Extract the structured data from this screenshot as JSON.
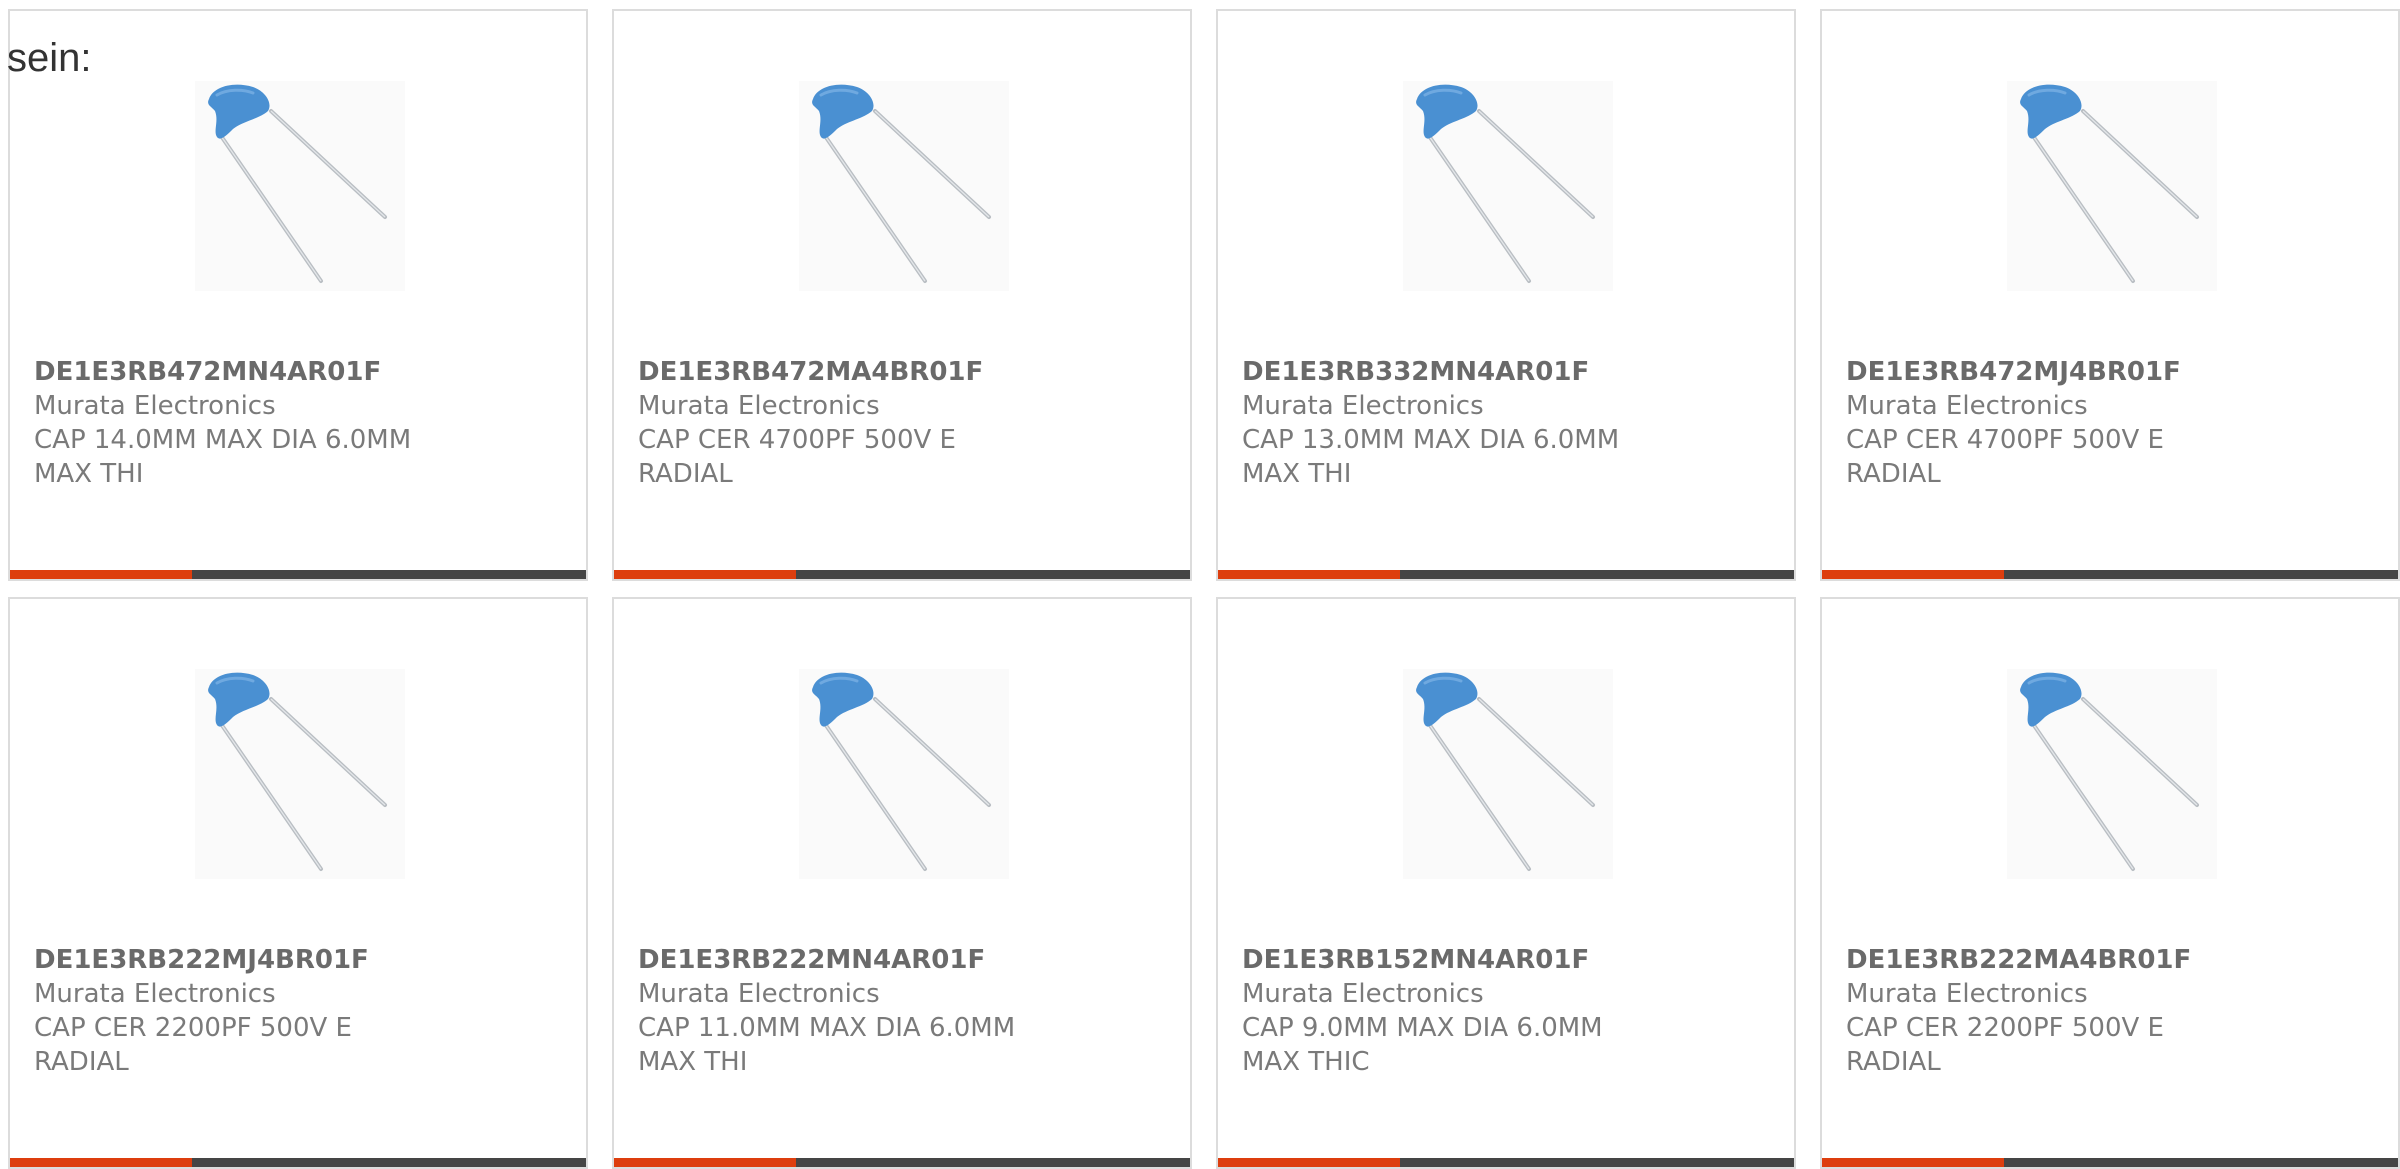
{
  "intro_text": "sein:",
  "colors": {
    "accent": "#dd3e0e",
    "bar": "#454545",
    "capacitor_body": "#4a90d2",
    "border": "#dcdcdc"
  },
  "products": [
    {
      "part": "DE1E3RB472MN4AR01F",
      "manufacturer": "Murata Electronics",
      "description": "CAP 14.0MM MAX DIA 6.0MM MAX THI",
      "image_icon": "ceramic-disc-capacitor-icon"
    },
    {
      "part": "DE1E3RB472MA4BR01F",
      "manufacturer": "Murata Electronics",
      "description": "CAP CER 4700PF 500V E RADIAL",
      "image_icon": "ceramic-disc-capacitor-icon"
    },
    {
      "part": "DE1E3RB332MN4AR01F",
      "manufacturer": "Murata Electronics",
      "description": "CAP 13.0MM MAX DIA 6.0MM MAX THI",
      "image_icon": "ceramic-disc-capacitor-icon"
    },
    {
      "part": "DE1E3RB472MJ4BR01F",
      "manufacturer": "Murata Electronics",
      "description": "CAP CER 4700PF 500V E RADIAL",
      "image_icon": "ceramic-disc-capacitor-icon"
    },
    {
      "part": "DE1E3RB222MJ4BR01F",
      "manufacturer": "Murata Electronics",
      "description": "CAP CER 2200PF 500V E RADIAL",
      "image_icon": "ceramic-disc-capacitor-icon"
    },
    {
      "part": "DE1E3RB222MN4AR01F",
      "manufacturer": "Murata Electronics",
      "description": "CAP 11.0MM MAX DIA 6.0MM MAX THI",
      "image_icon": "ceramic-disc-capacitor-icon"
    },
    {
      "part": "DE1E3RB152MN4AR01F",
      "manufacturer": "Murata Electronics",
      "description": "CAP 9.0MM MAX DIA 6.0MM MAX THIC",
      "image_icon": "ceramic-disc-capacitor-icon"
    },
    {
      "part": "DE1E3RB222MA4BR01F",
      "manufacturer": "Murata Electronics",
      "description": "CAP CER 2200PF 500V E RADIAL",
      "image_icon": "ceramic-disc-capacitor-icon"
    }
  ]
}
